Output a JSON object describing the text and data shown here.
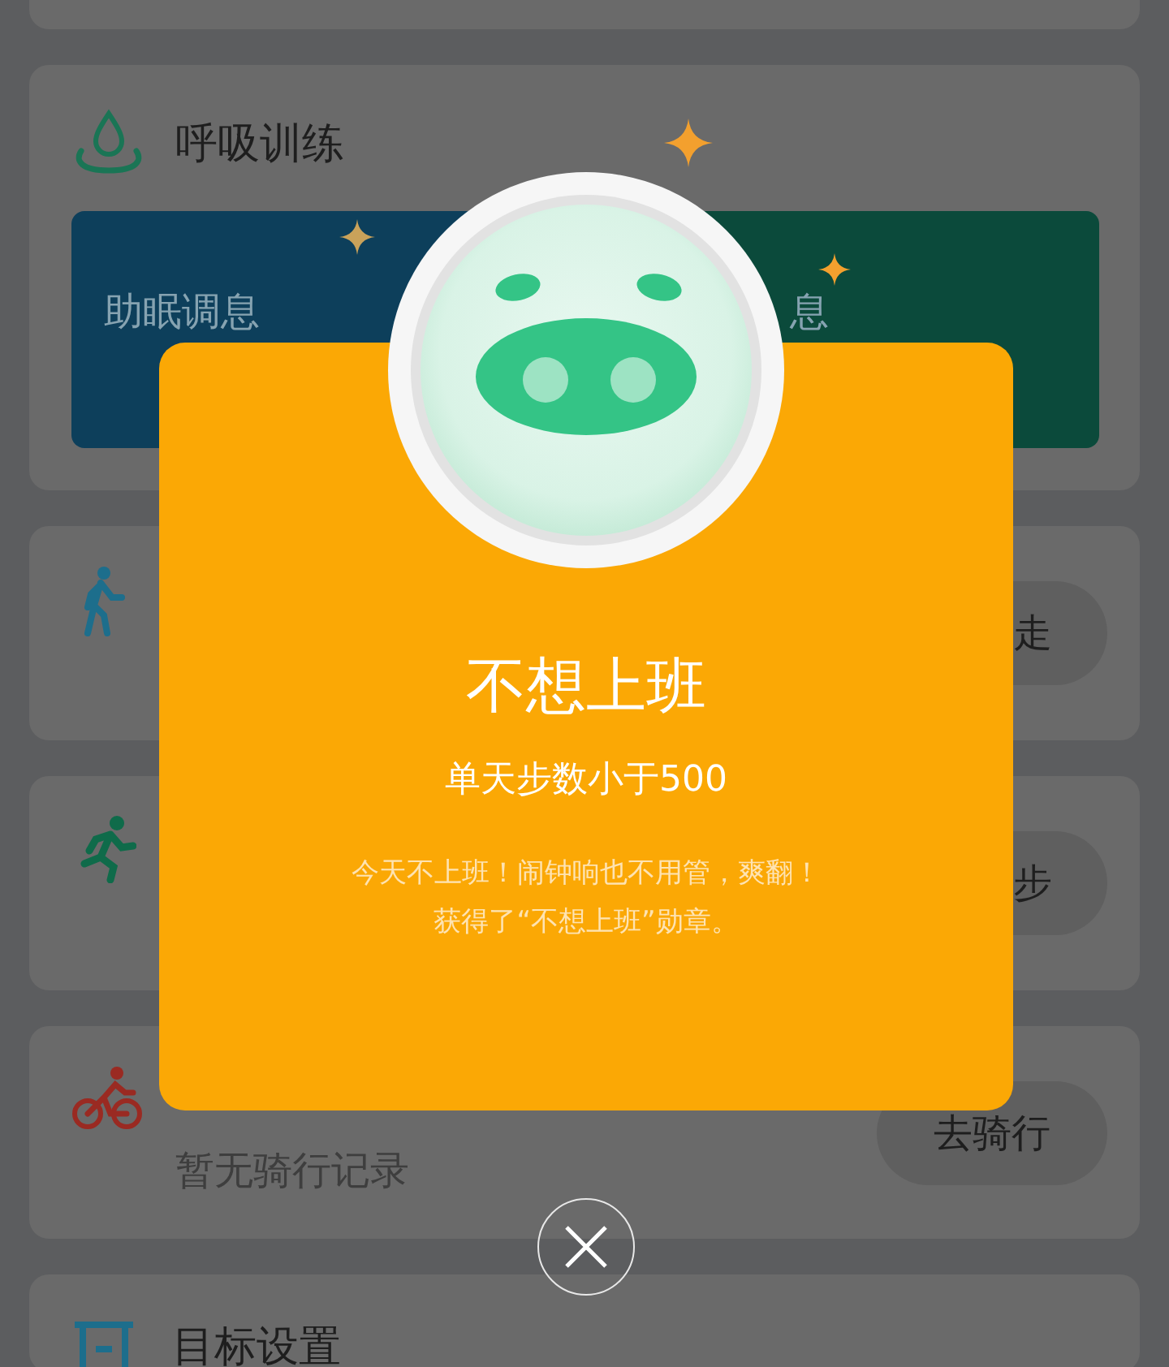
{
  "breathing": {
    "title": "呼吸训练",
    "options": [
      {
        "label": "助眠调息",
        "color": "#0d3f5b"
      },
      {
        "label": "息",
        "color": "#0b4a3b"
      }
    ]
  },
  "activities": [
    {
      "kind": "walk",
      "button": "走"
    },
    {
      "kind": "run",
      "button": "步"
    },
    {
      "kind": "cycle",
      "subtitle": "暂无骑行记录",
      "button": "去骑行"
    }
  ],
  "goal": {
    "title": "目标设置"
  },
  "badge_dialog": {
    "title": "不想上班",
    "condition": "单天步数小于500",
    "description": [
      "今天不上班！闹钟响也不用管，爽翻！",
      "获得了“不想上班”勋章。"
    ]
  }
}
